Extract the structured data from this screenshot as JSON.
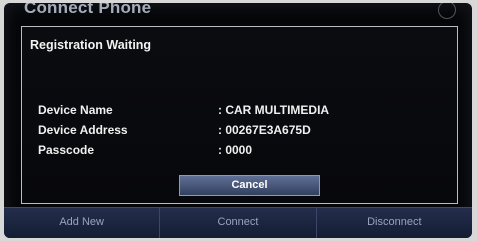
{
  "screen": {
    "title": "Connect Phone"
  },
  "dialog": {
    "title": "Registration Waiting",
    "rows": [
      {
        "label": "Device Name",
        "value": ": CAR MULTIMEDIA"
      },
      {
        "label": "Device Address",
        "value": ": 00267E3A675D"
      },
      {
        "label": "Passcode",
        "value": ": 0000"
      }
    ],
    "cancel_label": "Cancel"
  },
  "tabs": [
    {
      "label": "Add New"
    },
    {
      "label": "Connect"
    },
    {
      "label": "Disconnect"
    }
  ],
  "colors": {
    "background": "#050608",
    "button_accent": "#4a5a80",
    "tabbar": "#1c2540"
  }
}
